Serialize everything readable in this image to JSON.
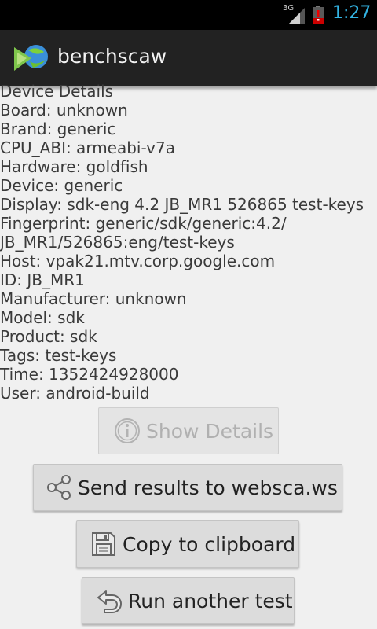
{
  "status_bar": {
    "network": "3G",
    "time": "1:27",
    "signal_icon": "signal-icon",
    "battery_icon": "battery-alert-icon"
  },
  "action_bar": {
    "app_icon": "benchscaw-logo-icon",
    "title": "benchscaw"
  },
  "details": {
    "lines": [
      "Device Details",
      "Board: unknown",
      "Brand: generic",
      "CPU_ABI: armeabi-v7a",
      "Hardware: goldfish",
      "Device: generic",
      "Display: sdk-eng 4.2 JB_MR1 526865 test-keys",
      "Fingerprint: generic/sdk/generic:4.2/",
      "JB_MR1/526865:eng/test-keys",
      "Host: vpak21.mtv.corp.google.com",
      "ID: JB_MR1",
      "Manufacturer: unknown",
      "Model: sdk",
      "Product: sdk",
      "Tags: test-keys",
      "Time: 1352424928000",
      "User: android-build"
    ]
  },
  "buttons": {
    "show_details": {
      "label": "Show Details",
      "icon": "info-icon",
      "enabled": false
    },
    "send_results": {
      "label": "Send results to websca.ws",
      "icon": "share-icon"
    },
    "copy_clipboard": {
      "label": "Copy to clipboard",
      "icon": "save-icon"
    },
    "run_again": {
      "label": "Run another test",
      "icon": "undo-icon"
    }
  },
  "colors": {
    "status_time": "#33b5e5",
    "action_bar_bg": "#222222",
    "background": "#f0f0f0"
  }
}
